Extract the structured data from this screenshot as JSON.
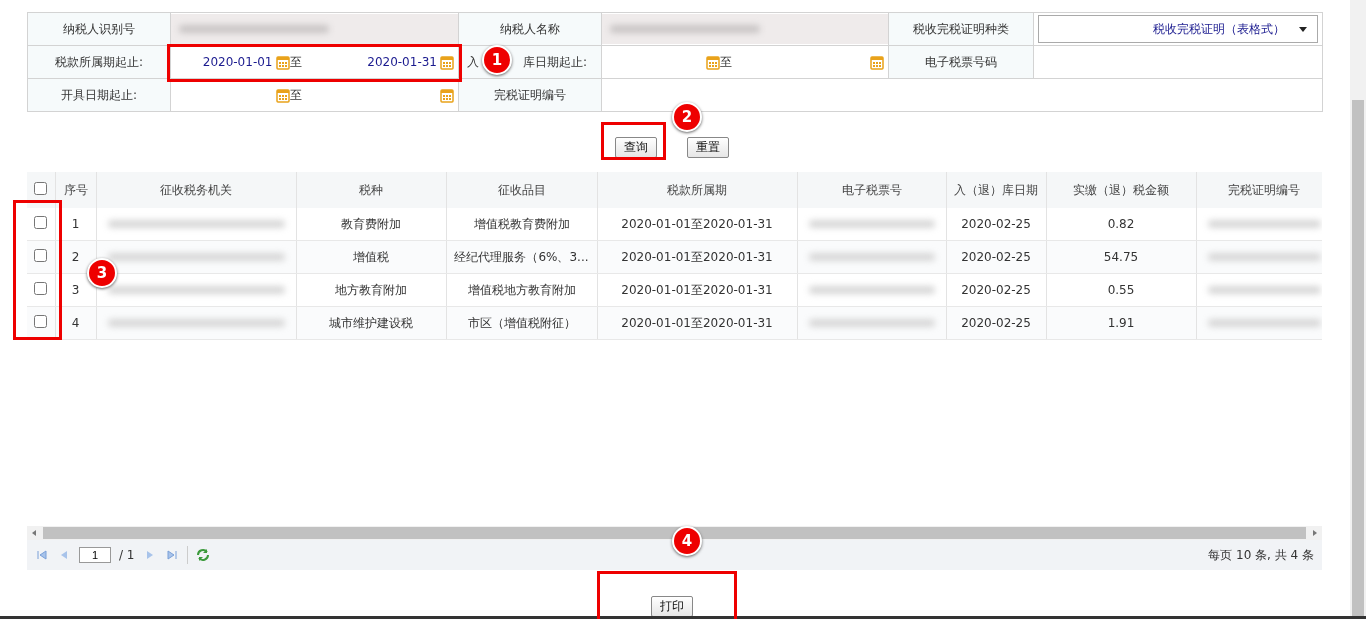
{
  "form": {
    "rows": [
      [
        {
          "kind": "label",
          "text": "纳税人识别号"
        },
        {
          "kind": "redacted"
        },
        {
          "kind": "label",
          "text": "纳税人名称"
        },
        {
          "kind": "redacted"
        },
        {
          "kind": "label",
          "text": "税收完税证明种类"
        },
        {
          "kind": "select",
          "value": "税收完税证明（表格式）"
        }
      ],
      [
        {
          "kind": "label",
          "text": "税款所属期起止:"
        },
        {
          "kind": "date_range",
          "from": "2020-01-01",
          "separator": "至",
          "to": "2020-01-31"
        },
        {
          "kind": "label_parts",
          "parts": [
            "入",
            "库日期起止:"
          ]
        },
        {
          "kind": "date_range",
          "separator": "至"
        },
        {
          "kind": "label",
          "text": "电子税票号码"
        },
        {
          "kind": "input"
        }
      ],
      [
        {
          "kind": "label",
          "text": "开具日期起止:"
        },
        {
          "kind": "date_range",
          "separator": "至"
        },
        {
          "kind": "label",
          "text": "完税证明编号"
        },
        {
          "kind": "input"
        }
      ]
    ]
  },
  "actions": [
    {
      "label": "查询"
    },
    {
      "label": "重置"
    }
  ],
  "grid": {
    "header_checkbox": {
      "checked": false
    },
    "columns": [
      {
        "label": "序号",
        "kind": "no"
      },
      {
        "label": "征收税务机关",
        "kind": "redacted"
      },
      {
        "label": "税种",
        "kind": "text"
      },
      {
        "label": "征收品目",
        "kind": "text"
      },
      {
        "label": "税款所属期",
        "kind": "text"
      },
      {
        "label": "电子税票号",
        "kind": "redacted"
      },
      {
        "label": "入（退）库日期",
        "kind": "text"
      },
      {
        "label": "实缴（退）税金额",
        "kind": "text"
      },
      {
        "label": "完税证明编号",
        "kind": "redacted"
      }
    ],
    "rows": [
      {
        "checked": false,
        "cells": [
          "1",
          "",
          "教育费附加",
          "增值税教育费附加",
          "2020-01-01至2020-01-31",
          "",
          "2020-02-25",
          "0.82",
          ""
        ]
      },
      {
        "checked": false,
        "cells": [
          "2",
          "",
          "增值税",
          "经纪代理服务（6%、3...",
          "2020-01-01至2020-01-31",
          "",
          "2020-02-25",
          "54.75",
          ""
        ]
      },
      {
        "checked": false,
        "cells": [
          "3",
          "",
          "地方教育附加",
          "增值税地方教育附加",
          "2020-01-01至2020-01-31",
          "",
          "2020-02-25",
          "0.55",
          ""
        ]
      },
      {
        "checked": false,
        "cells": [
          "4",
          "",
          "城市维护建设税",
          "市区（增值税附征）",
          "2020-01-01至2020-01-31",
          "",
          "2020-02-25",
          "1.91",
          ""
        ]
      }
    ]
  },
  "pager": {
    "page": "1",
    "total_pages": "/ 1",
    "summary": "每页 10 条, 共 4 条"
  },
  "print_button": {
    "label": "打印"
  },
  "annotations": [
    {
      "label": "1"
    },
    {
      "label": "2"
    },
    {
      "label": "3"
    },
    {
      "label": "4"
    }
  ]
}
